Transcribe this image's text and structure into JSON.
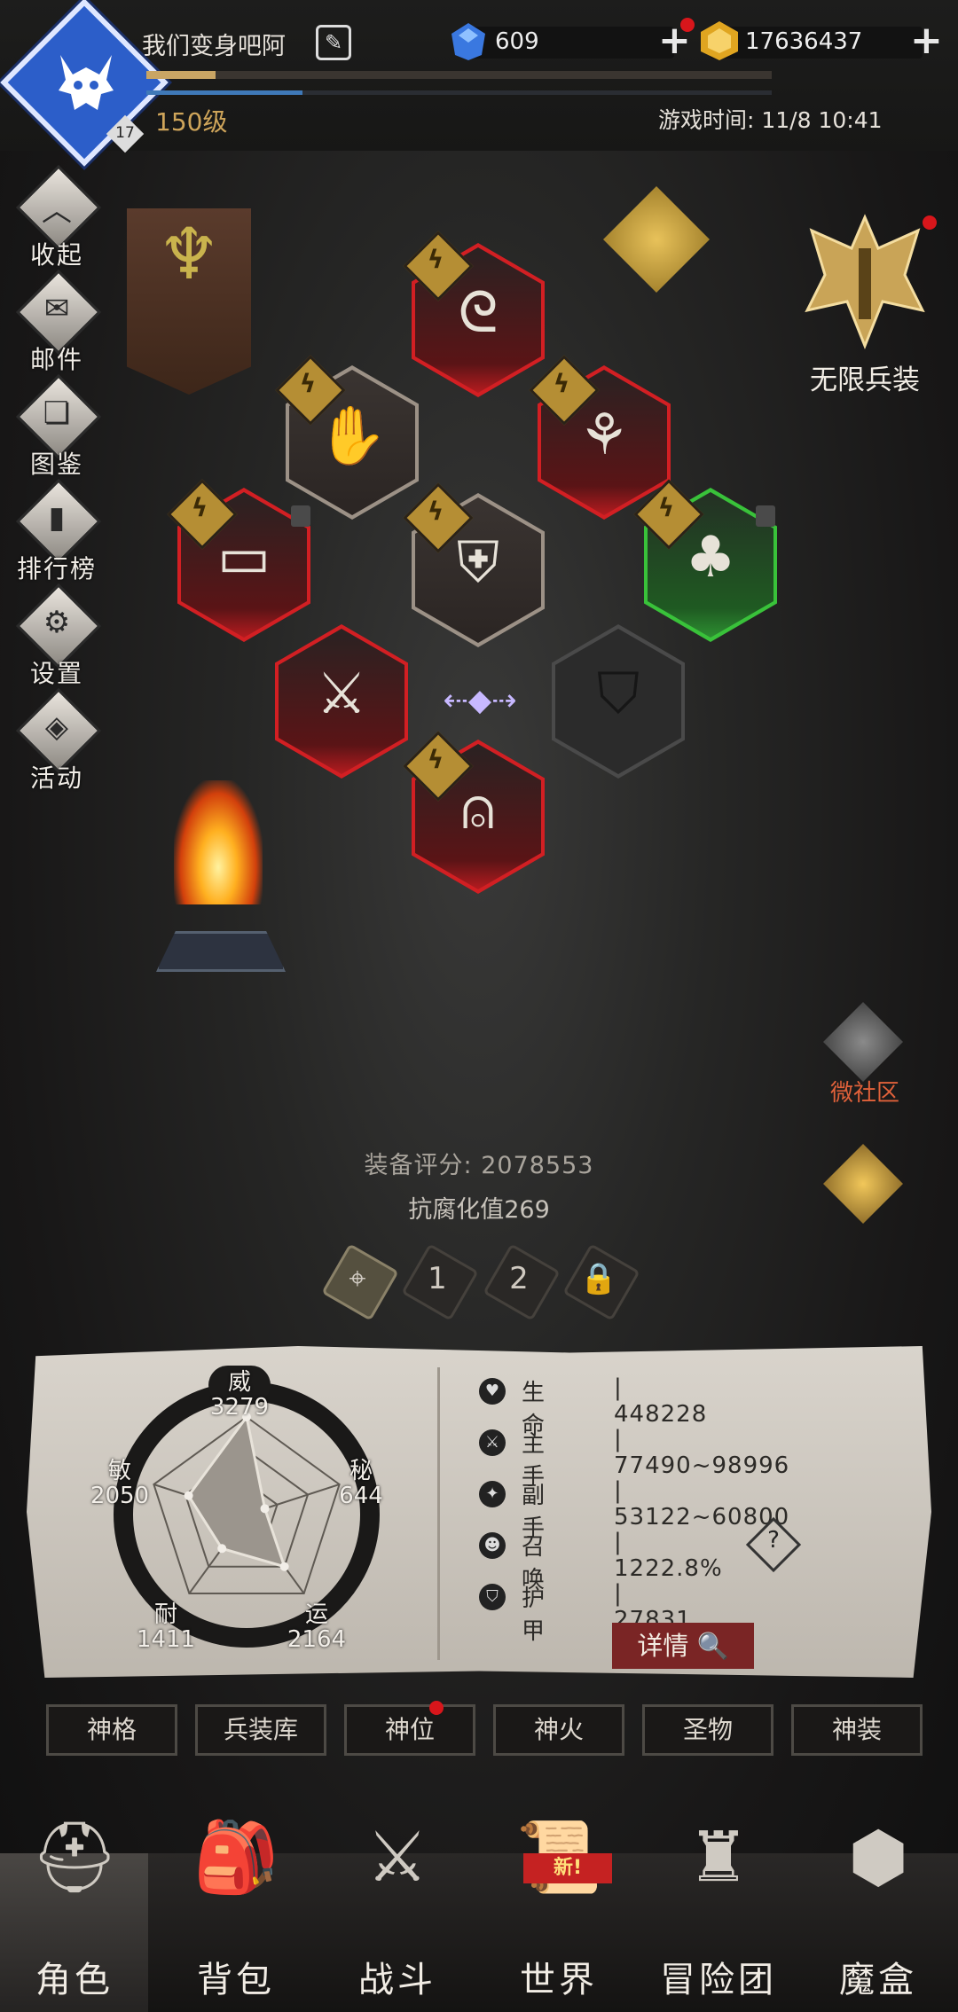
{
  "player": {
    "name": "我们变身吧阿",
    "level": "150级",
    "level_badge": "17",
    "xp_progress": 0.11,
    "mp_progress": 0.25
  },
  "currency": {
    "gems": "609",
    "gold": "17636437"
  },
  "game_time": "游戏时间: 11/8 10:41",
  "side_menu": [
    {
      "label": "收起",
      "icon": "collapse-icon",
      "glyph": "︿"
    },
    {
      "label": "邮件",
      "icon": "mail-icon",
      "glyph": "✉"
    },
    {
      "label": "图鉴",
      "icon": "book-icon",
      "glyph": "❏"
    },
    {
      "label": "排行榜",
      "icon": "ranking-icon",
      "glyph": "▮"
    },
    {
      "label": "设置",
      "icon": "gear-icon",
      "glyph": "⚙"
    },
    {
      "label": "活动",
      "icon": "activity-icon",
      "glyph": "◈"
    }
  ],
  "infinite_gear": {
    "label": "无限兵装"
  },
  "community": {
    "label": "微社区"
  },
  "equipment_score": "装备评分: 2078553",
  "corruption": "抗腐化值269",
  "presets": [
    "1",
    "2"
  ],
  "attributes": [
    {
      "name": "威",
      "value": "3279"
    },
    {
      "name": "秘",
      "value": "644"
    },
    {
      "name": "运",
      "value": "2164"
    },
    {
      "name": "耐",
      "value": "1411"
    },
    {
      "name": "敏",
      "value": "2050"
    }
  ],
  "stats": [
    {
      "name": "生命",
      "value": "448228",
      "icon": "heart-icon",
      "glyph": "♥"
    },
    {
      "name": "主手",
      "value": "77490~98996",
      "icon": "sword-icon",
      "glyph": "⚔"
    },
    {
      "name": "副手",
      "value": "53122~60800",
      "icon": "offhand-icon",
      "glyph": "✦"
    },
    {
      "name": "召唤",
      "value": "1222.8%",
      "icon": "summon-icon",
      "glyph": "☻"
    },
    {
      "name": "护甲",
      "value": "27831",
      "icon": "armor-icon",
      "glyph": "⛉"
    }
  ],
  "detail_button": "详情",
  "tabs": [
    "神格",
    "兵装库",
    "神位",
    "神火",
    "圣物",
    "神装"
  ],
  "bottom_nav": [
    {
      "label": "角色",
      "icon": "helmet-icon",
      "glyph": "⛑"
    },
    {
      "label": "背包",
      "icon": "backpack-icon",
      "glyph": "🎒"
    },
    {
      "label": "战斗",
      "icon": "shield-sword-icon",
      "glyph": "⚔"
    },
    {
      "label": "世界",
      "icon": "scroll-icon",
      "glyph": "📜"
    },
    {
      "label": "冒险团",
      "icon": "castle-icon",
      "glyph": "♜"
    },
    {
      "label": "魔盒",
      "icon": "box-icon",
      "glyph": "⬢"
    }
  ],
  "new_badge": "新!",
  "colors": {
    "accent_gold": "#cfa55a",
    "detail_red": "#7a2525",
    "slot_red": "#d21f23",
    "slot_green": "#39c23a"
  }
}
